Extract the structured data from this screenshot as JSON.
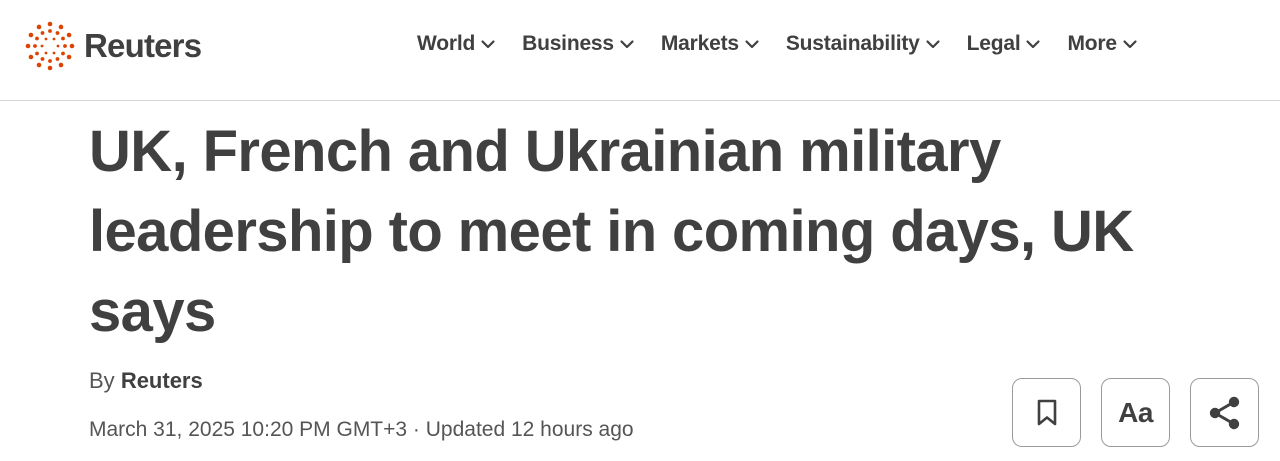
{
  "brand": {
    "name": "Reuters",
    "accent": "#dc4300"
  },
  "nav": {
    "items": [
      {
        "label": "World"
      },
      {
        "label": "Business"
      },
      {
        "label": "Markets"
      },
      {
        "label": "Sustainability"
      },
      {
        "label": "Legal"
      },
      {
        "label": "More"
      }
    ],
    "icon": "chevron-down-icon"
  },
  "article": {
    "headline": "UK, French and Ukrainian military leadership to meet in coming days, UK says",
    "byline_prefix": "By",
    "author": "Reuters",
    "dateline": "March 31, 2025 10:20 PM GMT+3 · Updated 12 hours ago"
  },
  "actions": {
    "bookmark_icon": "bookmark-icon",
    "text_size_label": "Aa",
    "share_icon": "share-icon"
  },
  "colors": {
    "text": "#404040",
    "divider": "#d6d6d6",
    "button_border": "#9a9a9a"
  }
}
